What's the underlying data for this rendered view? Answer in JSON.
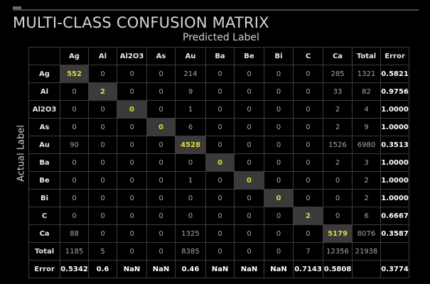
{
  "title": "MULTI-CLASS CONFUSION MATRIX",
  "xlabel": "Predicted Label",
  "ylabel": "Actual Label",
  "chart_data": {
    "type": "table",
    "title": "MULTI-CLASS CONFUSION MATRIX",
    "xlabel": "Predicted Label",
    "ylabel": "Actual Label",
    "columns": [
      "Ag",
      "Al",
      "Al2O3",
      "As",
      "Au",
      "Ba",
      "Be",
      "Bi",
      "C",
      "Ca",
      "Total",
      "Error"
    ],
    "rows": [
      {
        "label": "Ag",
        "values": [
          "552",
          "0",
          "0",
          "0",
          "214",
          "0",
          "0",
          "0",
          "0",
          "285",
          "1321",
          "0.5821"
        ]
      },
      {
        "label": "Al",
        "values": [
          "0",
          "2",
          "0",
          "0",
          "9",
          "0",
          "0",
          "0",
          "0",
          "33",
          "82",
          "0.9756"
        ]
      },
      {
        "label": "Al2O3",
        "values": [
          "0",
          "0",
          "0",
          "0",
          "1",
          "0",
          "0",
          "0",
          "0",
          "2",
          "4",
          "1.0000"
        ]
      },
      {
        "label": "As",
        "values": [
          "0",
          "0",
          "0",
          "0",
          "6",
          "0",
          "0",
          "0",
          "0",
          "2",
          "9",
          "1.0000"
        ]
      },
      {
        "label": "Au",
        "values": [
          "90",
          "0",
          "0",
          "0",
          "4528",
          "0",
          "0",
          "0",
          "0",
          "1526",
          "6980",
          "0.3513"
        ]
      },
      {
        "label": "Ba",
        "values": [
          "0",
          "0",
          "0",
          "0",
          "0",
          "0",
          "0",
          "0",
          "0",
          "2",
          "3",
          "1.0000"
        ]
      },
      {
        "label": "Be",
        "values": [
          "0",
          "0",
          "0",
          "0",
          "1",
          "0",
          "0",
          "0",
          "0",
          "0",
          "2",
          "1.0000"
        ]
      },
      {
        "label": "Bi",
        "values": [
          "0",
          "0",
          "0",
          "0",
          "0",
          "0",
          "0",
          "0",
          "0",
          "0",
          "2",
          "1.0000"
        ]
      },
      {
        "label": "C",
        "values": [
          "0",
          "0",
          "0",
          "0",
          "0",
          "0",
          "0",
          "0",
          "2",
          "0",
          "6",
          "0.6667"
        ]
      },
      {
        "label": "Ca",
        "values": [
          "88",
          "0",
          "0",
          "0",
          "1325",
          "0",
          "0",
          "0",
          "0",
          "5179",
          "8076",
          "0.3587"
        ]
      },
      {
        "label": "Total",
        "values": [
          "1185",
          "5",
          "0",
          "0",
          "8385",
          "0",
          "0",
          "0",
          "7",
          "12356",
          "21938",
          ""
        ]
      },
      {
        "label": "Error",
        "values": [
          "0.5342",
          "0.6",
          "NaN",
          "NaN",
          "0.46",
          "NaN",
          "NaN",
          "NaN",
          "0.7143",
          "0.5808",
          "",
          "0.3774"
        ]
      }
    ],
    "colors": {
      "diagonal_text": "#e3d93a",
      "diagonal_bg": "#3a3a3a",
      "grid": "#3c3c3c",
      "background": "#000000"
    }
  }
}
